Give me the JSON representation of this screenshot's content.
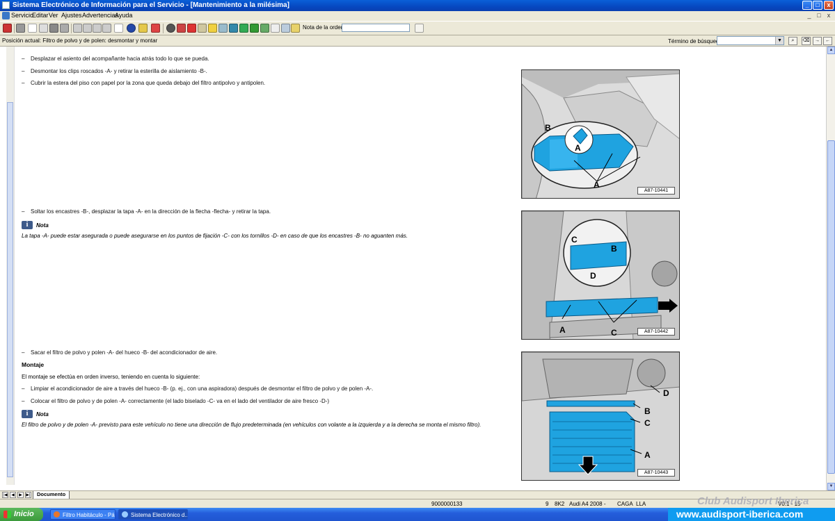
{
  "window": {
    "title": "Sistema Electrónico de Información para el Servicio - [Mantenimiento a la milésima]",
    "controls": [
      "_",
      "□",
      "x"
    ]
  },
  "menu": {
    "items": [
      "Servicio",
      "Editar",
      "Ver",
      "Ajustes",
      "Advertencias",
      "Ayuda"
    ],
    "mdi_controls": [
      "_",
      "□",
      "x"
    ]
  },
  "toolbar": {
    "order_note_label": "Nota de la orden:",
    "order_note_value": "",
    "icons": [
      "exit-icon",
      "print-icon",
      "page-icon",
      "edit-icon",
      "car-icon",
      "car-alt-icon",
      "first-icon",
      "prev-icon",
      "next-icon",
      "last-icon",
      "up-level-icon",
      "info-icon",
      "key-icon",
      "swap-icon",
      "wheel-icon",
      "tools-icon",
      "diagram-icon",
      "calc-icon",
      "warning-icon",
      "sheet-icon",
      "globe-icon",
      "paint-icon",
      "car-green-icon",
      "edit-green-icon",
      "checklist-icon",
      "search-doc-icon",
      "tool-red-icon",
      "note-icon"
    ]
  },
  "position_bar": {
    "position_text": "Posición actual: Filtro de polvo y de polen: desmontar y montar",
    "search_label": "Término de búsqueda:",
    "search_value": ""
  },
  "document": {
    "step1a": "Desplazar el asiento del acompañante hacia atrás todo lo que se pueda.",
    "step1b": "Desmontar los clips roscados -A- y retirar la esterilla de aislamiento -B-.",
    "step1c": "Cubrir la estera del piso con papel por la zona que queda debajo del filtro antipolvo y antipolen.",
    "step2": "Soltar los encastres -B-, desplazar la tapa -A- en la dirección de la flecha -flecha- y retirar la tapa.",
    "note_label": "Nota",
    "note1": "La tapa -A- puede estar asegurada o puede asegurarse en los puntos de fijación -C- con los tornillos -D- en caso de que los encastres -B- no aguanten más.",
    "step3": "Sacar el filtro de polvo y polen -A- del hueco -B- del acondicionador de aire.",
    "heading_montaje": "Montaje",
    "montaje_intro": "El montaje se efectúa en orden inverso, teniendo en cuenta lo siguiente:",
    "step4": "Limpiar el acondicionador de aire a través del hueco -B- (p. ej., con una aspiradora) después de desmontar el filtro de polvo y de polen -A-.",
    "step5": "Colocar el filtro de polvo y de polen -A- correctamente (el lado biselado -C- va en el lado del ventilador de aire fresco -D-)",
    "note2": "El filtro de polvo y de polen -A- previsto para este vehículo no tiene una dirección de flujo predeterminada (en vehículos con volante a la izquierda y a la derecha se monta el mismo filtro).",
    "figures": [
      {
        "code": "A87-10441",
        "labels": [
          "B",
          "A",
          "A"
        ]
      },
      {
        "code": "A87-10442",
        "labels": [
          "C",
          "B",
          "D",
          "A",
          "C"
        ]
      },
      {
        "code": "A87-10443",
        "labels": [
          "D",
          "B",
          "C",
          "A"
        ]
      }
    ]
  },
  "tabs": {
    "document_tab": "Documento"
  },
  "status": {
    "order_number": "9000000133",
    "field1": "9",
    "field2": "8K2",
    "vehicle": "Audi A4 2008 -",
    "engine": "CAGA",
    "market": "LLA",
    "version": "V0.1 - 15"
  },
  "watermark": {
    "text": "Club Audisport Iberica"
  },
  "taskbar": {
    "start_label": "Inicio",
    "tasks": [
      "Filtro Habitáculo - Pá...",
      "Sistema Electrónico d..."
    ],
    "tray_url": "www.audisport-iberica.com"
  },
  "colors": {
    "accent": "#0a5fd8",
    "filter_blue": "#1fa3e0",
    "taskbar": "#245edb"
  }
}
